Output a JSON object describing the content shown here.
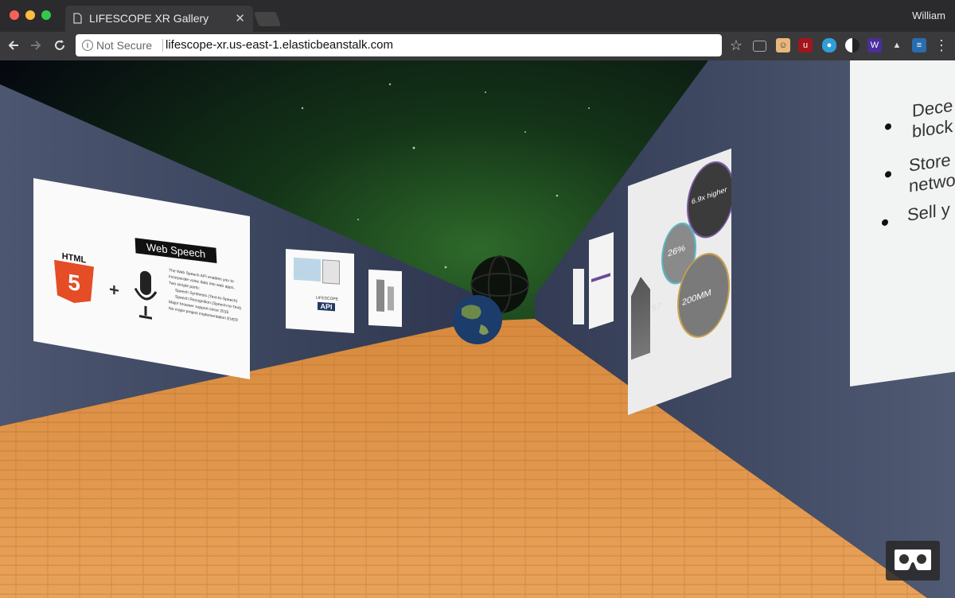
{
  "browser": {
    "tab_title": "LIFESCOPE XR Gallery",
    "user_name": "William",
    "security_label": "Not Secure",
    "url": "lifescope-xr.us-east-1.elasticbeanstalk.com"
  },
  "gallery": {
    "left_panel": {
      "title": "Web Speech",
      "logo_text": "HTML",
      "logo_number": "5",
      "bullets": [
        "The Web Speech API enables you to incorporate voice data into web apps.",
        "Two simple parts:",
        "Speech Synthesis (Text-to-Speech)",
        "Speech Recognition (Speech-to-Text)",
        "Major browser support since 2015",
        "No major project implementation EVER"
      ]
    },
    "api_panel": {
      "label": "LIFESCOPE",
      "api": "API"
    },
    "stats_panel": {
      "stat1": "6.9x higher",
      "stat2": "26%",
      "stat3": "200MM",
      "stat4": "57"
    },
    "near_panel": {
      "bullets": [
        "Dece",
        "block",
        "Store",
        "netwo",
        "Sell y"
      ]
    }
  }
}
